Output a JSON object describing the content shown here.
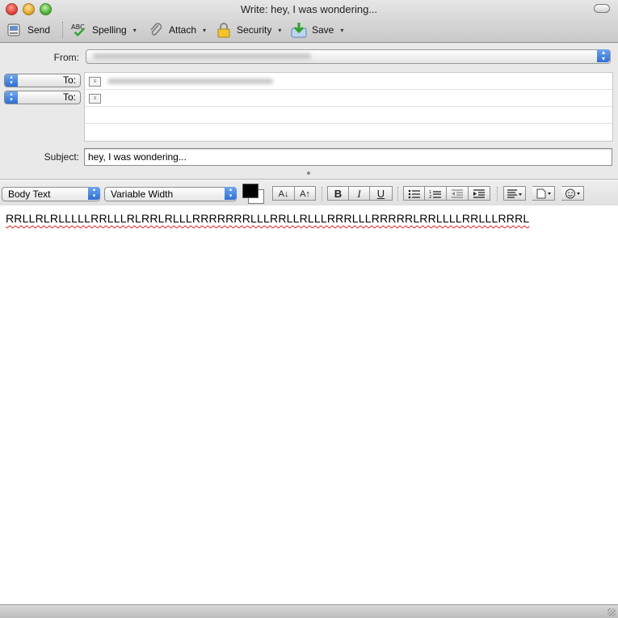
{
  "window": {
    "title": "Write: hey, I was wondering..."
  },
  "toolbar": {
    "send": "Send",
    "spelling": "Spelling",
    "attach": "Attach",
    "security": "Security",
    "save": "Save",
    "caret": "▾"
  },
  "header": {
    "from_label": "From:",
    "to_label": "To:",
    "subject_label": "Subject:",
    "subject_value": "hey, I was wondering..."
  },
  "format": {
    "style": "Body Text",
    "font": "Variable Width",
    "smaller": "A↓",
    "larger": "A↑",
    "bold": "B",
    "italic": "I",
    "underline": "U",
    "text_color": "#000000",
    "bg_color": "#ffffff"
  },
  "body": {
    "text": "RRLLRLRLLLLLRRLLLRLRRLRLLLRRRRRRRLLLRRLLRLLLRRRLLLRRRRRLRRLLLLRRLLLRRRL"
  }
}
